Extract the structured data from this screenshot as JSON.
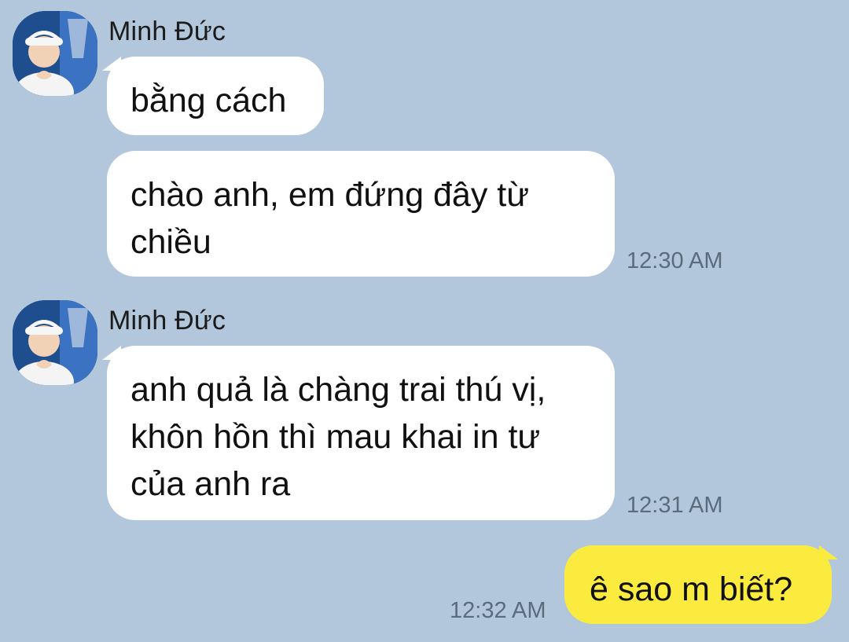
{
  "chat": {
    "sender_name": "Minh Đức",
    "messages": [
      {
        "direction": "in",
        "text": "bằng cách",
        "time": ""
      },
      {
        "direction": "in",
        "text": "chào anh, em đứng đây từ\nchiều",
        "time": "12:30 AM"
      },
      {
        "direction": "in",
        "text": "anh quả là chàng trai thú vị,\nkhôn hồn thì mau khai in tư\ncủa anh ra",
        "time": "12:31 AM"
      },
      {
        "direction": "out",
        "text": "ê sao m biết?",
        "time": "12:32 AM"
      }
    ]
  },
  "colors": {
    "background": "#b3c7dc",
    "incoming_bubble": "#ffffff",
    "outgoing_bubble": "#fbeb3e",
    "timestamp": "#5c6b7c"
  }
}
